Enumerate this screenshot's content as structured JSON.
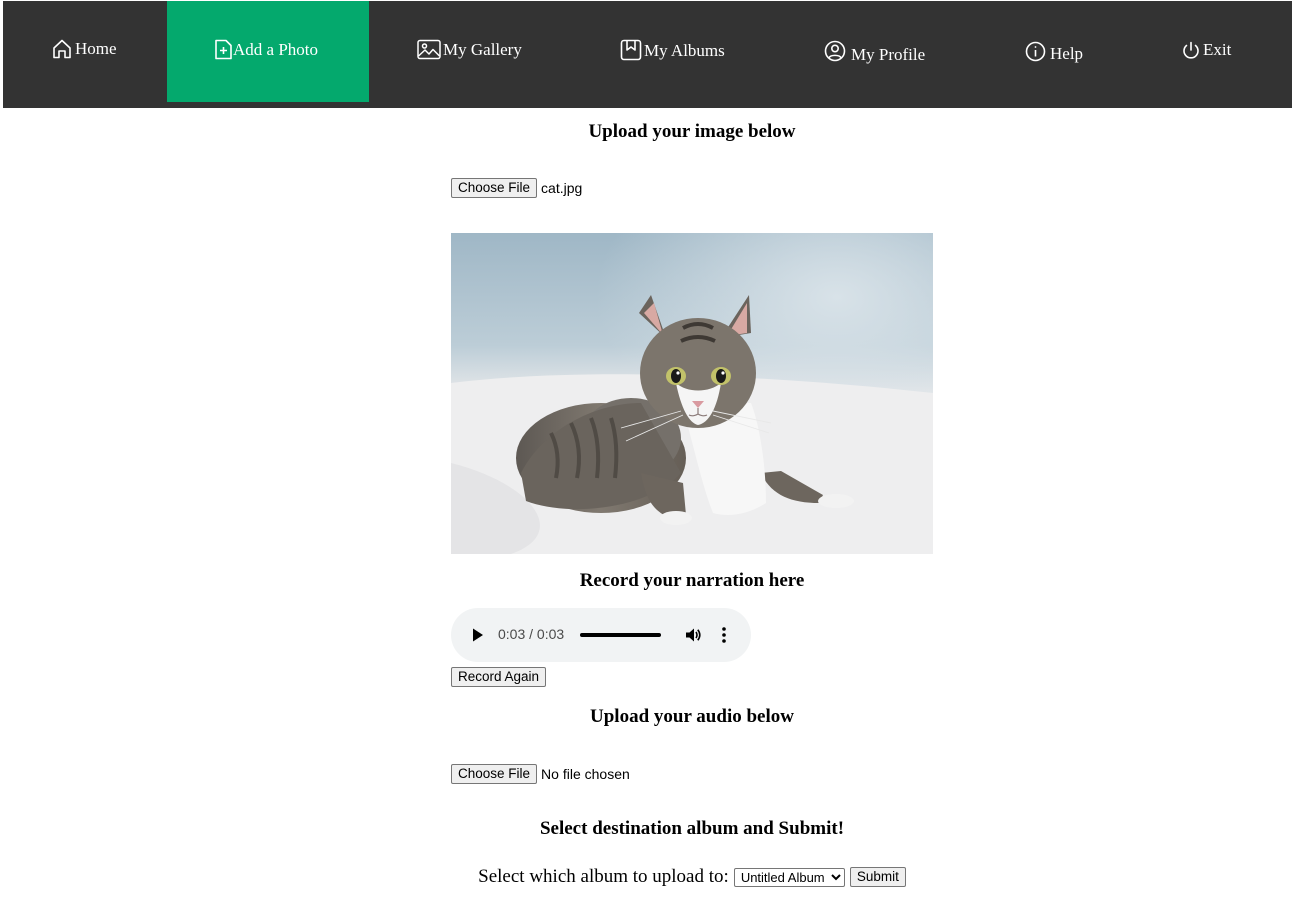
{
  "nav": {
    "items": [
      {
        "label": "Home",
        "icon": "home-icon"
      },
      {
        "label": "Add a Photo",
        "icon": "add-photo-icon"
      },
      {
        "label": "My Gallery",
        "icon": "image-icon"
      },
      {
        "label": "My Albums",
        "icon": "bookmark-icon"
      },
      {
        "label": "My Profile",
        "icon": "user-circle-icon"
      },
      {
        "label": "Help",
        "icon": "info-icon"
      },
      {
        "label": "Exit",
        "icon": "power-icon"
      }
    ],
    "active_item": "Add a Photo",
    "active_color": "#04a96d",
    "bar_color": "#333333"
  },
  "image_upload": {
    "heading": "Upload your image below",
    "button_label": "Choose File",
    "file_name": "cat.jpg"
  },
  "narration": {
    "heading": "Record your narration here",
    "time": "0:03 / 0:03",
    "progress": 1.0,
    "record_again_label": "Record Again"
  },
  "audio_upload": {
    "heading": "Upload your audio below",
    "button_label": "Choose File",
    "file_name": "No file chosen"
  },
  "submit_section": {
    "heading": "Select destination album and Submit!",
    "label": "Select which album to upload to:",
    "selected_album": "Untitled Album",
    "submit_label": "Submit"
  }
}
